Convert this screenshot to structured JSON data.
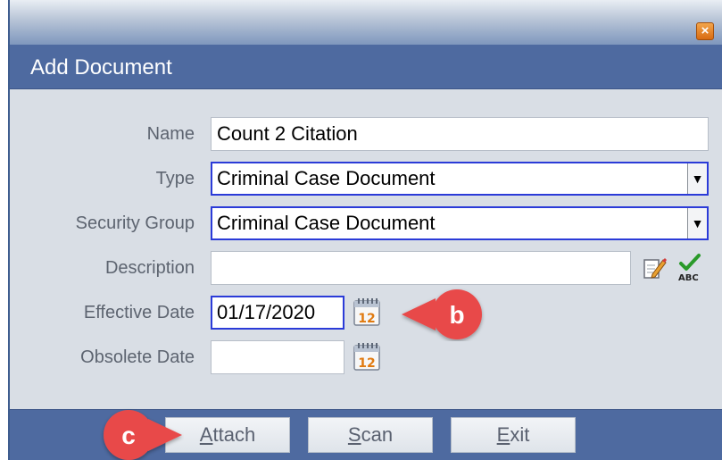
{
  "dialog": {
    "title": "Add Document",
    "close_glyph": "×"
  },
  "form": {
    "name": {
      "label": "Name",
      "value": "Count 2 Citation"
    },
    "type": {
      "label": "Type",
      "value": "Criminal Case Document"
    },
    "security_group": {
      "label": "Security Group",
      "value": "Criminal Case Document"
    },
    "description": {
      "label": "Description",
      "value": ""
    },
    "effective_date": {
      "label": "Effective Date",
      "value": "01/17/2020"
    },
    "obsolete_date": {
      "label": "Obsolete Date",
      "value": ""
    },
    "calendar_icon_text": "12",
    "spell_icon_text": "ABC"
  },
  "buttons": {
    "attach": {
      "hotkey": "A",
      "rest": "ttach"
    },
    "scan": {
      "hotkey": "S",
      "rest": "can"
    },
    "exit": {
      "hotkey": "E",
      "rest": "xit"
    }
  },
  "callouts": {
    "b": "b",
    "c": "c"
  },
  "colors": {
    "title_bar": "#4e6aa0",
    "callout_red": "#e84a4a",
    "focus_border": "#2b3bd8"
  }
}
